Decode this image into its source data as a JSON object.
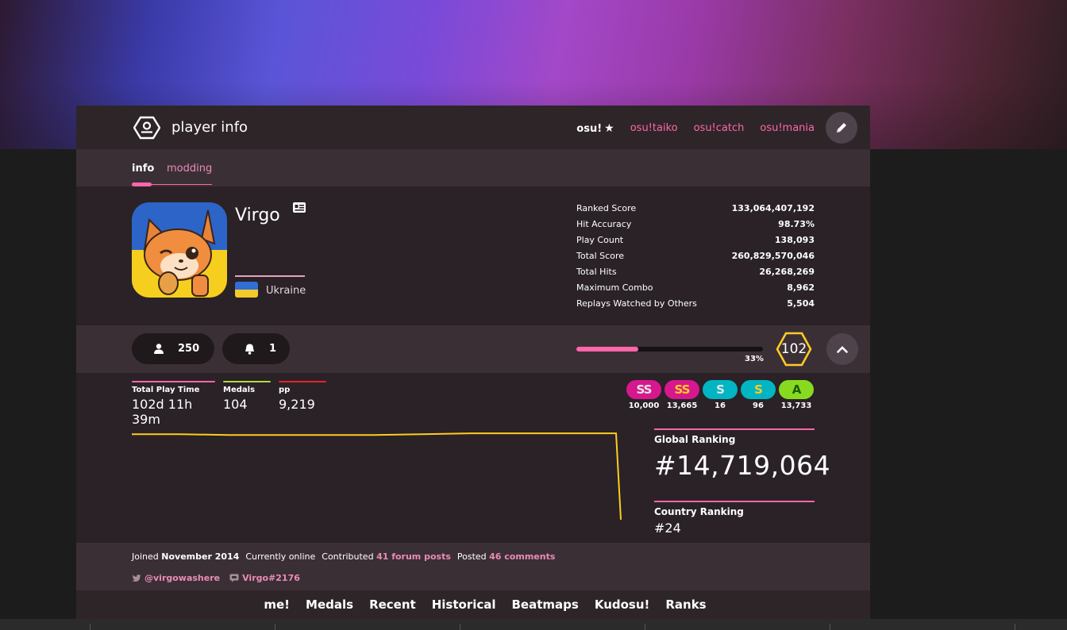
{
  "header": {
    "title": "player info",
    "modes": [
      {
        "label": "osu!",
        "active": true
      },
      {
        "label": "osu!taiko",
        "active": false
      },
      {
        "label": "osu!catch",
        "active": false
      },
      {
        "label": "osu!mania",
        "active": false
      }
    ]
  },
  "tabs": [
    {
      "label": "info",
      "active": true
    },
    {
      "label": "modding",
      "active": false
    }
  ],
  "profile": {
    "username": "Virgo",
    "country": "Ukraine"
  },
  "stats": [
    {
      "label": "Ranked Score",
      "value": "133,064,407,192"
    },
    {
      "label": "Hit Accuracy",
      "value": "98.73%"
    },
    {
      "label": "Play Count",
      "value": "138,093"
    },
    {
      "label": "Total Score",
      "value": "260,829,570,046"
    },
    {
      "label": "Total Hits",
      "value": "26,268,269"
    },
    {
      "label": "Maximum Combo",
      "value": "8,962"
    },
    {
      "label": "Replays Watched by Others",
      "value": "5,504"
    }
  ],
  "social": {
    "followers": "250",
    "mapping_subscribers": "1"
  },
  "level": {
    "value": "102",
    "progress_label": "33%",
    "progress": 0.33
  },
  "summary": [
    {
      "label": "Total Play Time",
      "value": "102d 11h 39m",
      "color": "#ff66aa"
    },
    {
      "label": "Medals",
      "value": "104",
      "color": "#b3d944"
    },
    {
      "label": "pp",
      "value": "9,219",
      "color": "#e3242b"
    }
  ],
  "grades": [
    {
      "grade": "SS",
      "count": "10,000",
      "bg": "#d6178e",
      "fg": "#e6e6e6"
    },
    {
      "grade": "SS",
      "count": "13,665",
      "bg": "#d6178e",
      "fg": "#ffcc22"
    },
    {
      "grade": "S",
      "count": "16",
      "bg": "#02b5c3",
      "fg": "#e6e6e6"
    },
    {
      "grade": "S",
      "count": "96",
      "bg": "#02b5c3",
      "fg": "#ffcc22"
    },
    {
      "grade": "A",
      "count": "13,733",
      "bg": "#88da20",
      "fg": "#1d5c00"
    }
  ],
  "rankings": {
    "global_label": "Global Ranking",
    "global_value": "#14,719,064",
    "country_label": "Country Ranking",
    "country_value": "#24"
  },
  "rank_history": {
    "color": "#ffcc22",
    "values": [
      0.98,
      0.98,
      0.97,
      0.97,
      0.97,
      0.97,
      0.98,
      0.99,
      0.99,
      0.99,
      0.99,
      0.0
    ]
  },
  "bio": {
    "joined_prefix": "Joined",
    "joined_date": "November 2014",
    "status": "Currently online",
    "contributed_prefix": "Contributed",
    "forum_posts": "41 forum posts",
    "posted_prefix": "Posted",
    "comments": "46 comments",
    "twitter": "@virgowashere",
    "discord": "Virgo#2176"
  },
  "nav": [
    "me!",
    "Medals",
    "Recent",
    "Historical",
    "Beatmaps",
    "Kudosu!",
    "Ranks"
  ]
}
